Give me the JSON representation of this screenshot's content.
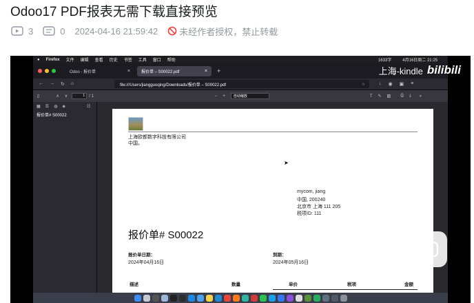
{
  "title": "Odoo17 PDF报表无需下载直接预览",
  "meta": {
    "plays": "3",
    "comments": "0",
    "datetime": "2024-04-16 21:59:42",
    "copyright_notice": "未经作者授权，禁止转载"
  },
  "video": {
    "watermark_text": "上海-kindle",
    "watermark_logo": "bilibili",
    "menubar": {
      "app": "Firefox",
      "items": [
        "文件",
        "编辑",
        "查看",
        "历史",
        "书签",
        "工具",
        "窗口",
        "帮助"
      ],
      "status": "1633字",
      "clock": "4月16日周二 21:25"
    },
    "tabs": [
      {
        "label": "Odoo - 报价单",
        "active": false
      },
      {
        "label": "报价单 – S00022.pdf",
        "active": true
      }
    ],
    "url": "file:///Users/jiangguoqing/Downloads/报价单 – S00022.pdf",
    "pdf_toolbar": {
      "page_input": "1",
      "page_total": "/ 1",
      "zoom": "自动缩放"
    },
    "sidebar_item": "报价单# S00022",
    "document": {
      "company_name": "上海欧都数字科技有限公司",
      "company_country": "中国。",
      "customer_name": "mycom, jiang",
      "customer_line2": "中国, 200240",
      "customer_line3": "北京市 上海 111 205",
      "customer_tax": "税项ID: 111",
      "heading": "报价单# S00022",
      "date_label": "报价单日期：",
      "date_value": "2024年04月16日",
      "expiry_label": "到期：",
      "expiry_value": "2024年05月16日",
      "col_desc": "描述",
      "col_qty": "数量",
      "col_price": "单价",
      "col_tax": "税项",
      "col_amount": "金额"
    }
  },
  "colors": {
    "title_text": "#18191c",
    "meta_text": "#9499a0",
    "forbid_red": "#f23b3b"
  }
}
